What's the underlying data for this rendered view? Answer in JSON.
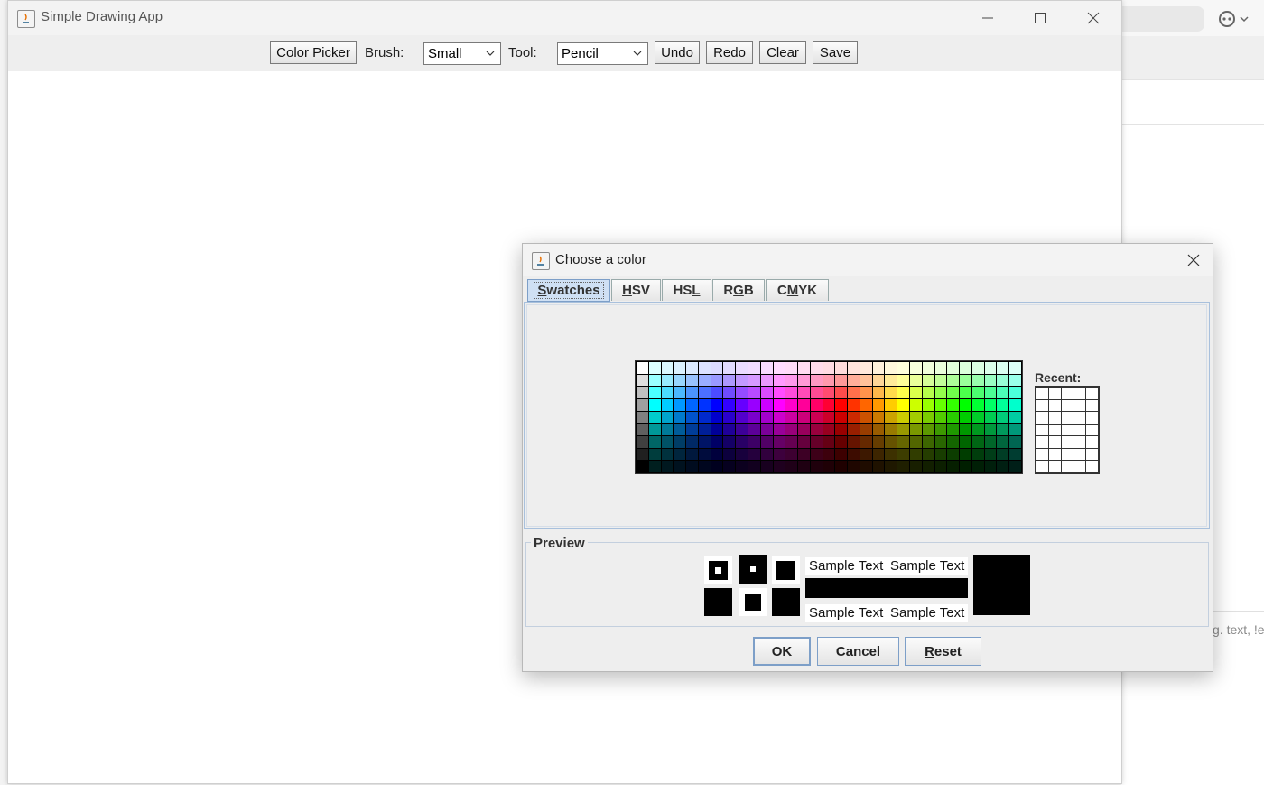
{
  "window": {
    "title": "Simple Drawing App"
  },
  "toolbar": {
    "color_picker_label": "Color Picker",
    "brush_label": "Brush:",
    "brush_value": "Small",
    "tool_label": "Tool:",
    "tool_value": "Pencil",
    "undo_label": "Undo",
    "redo_label": "Redo",
    "clear_label": "Clear",
    "save_label": "Save"
  },
  "dialog": {
    "title": "Choose a color",
    "tabs": [
      {
        "pre": "",
        "mn": "S",
        "post": "watches"
      },
      {
        "pre": "",
        "mn": "H",
        "post": "SV"
      },
      {
        "pre": "HS",
        "mn": "L",
        "post": ""
      },
      {
        "pre": "R",
        "mn": "G",
        "post": "B"
      },
      {
        "pre": "C",
        "mn": "M",
        "post": "YK"
      }
    ],
    "recent_label": "Recent:",
    "preview_label": "Preview",
    "sample_text": "Sample Text",
    "ok_label": "OK",
    "cancel_label": "Cancel",
    "reset_label": {
      "mn": "R",
      "post": "eset"
    },
    "selected_color": "#000000"
  },
  "background_app": {
    "hint_text": "g. text, !e"
  },
  "colors": {
    "accent": "#cfe0f4",
    "toolbar_bg": "#eeeeee",
    "canvas_bg": "#ffffff"
  }
}
